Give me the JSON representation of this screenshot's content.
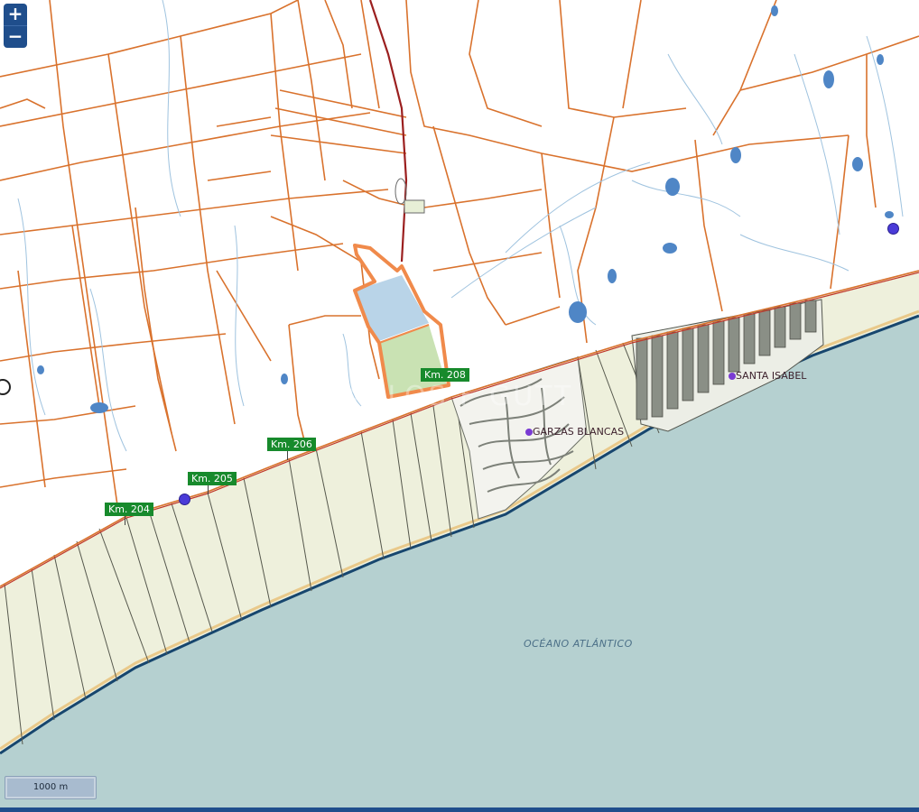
{
  "map": {
    "zoom_in_label": "+",
    "zoom_out_label": "−",
    "scale_label": "1000 m",
    "ocean_label": "OCÉANO ATLÁNTICO",
    "watermark": "CARLOS F GUTT",
    "places": [
      {
        "name": "GARZAS BLANCAS"
      },
      {
        "name": "SANTA ISABEL"
      }
    ],
    "km_markers": [
      "Km. 204",
      "Km. 205",
      "Km. 206",
      "Km. 208"
    ],
    "colors": {
      "ocean": "#b5d0d0",
      "parcel_lines": "#d9722d",
      "water": "#4f86c6",
      "coastal_lots": "#eef0dc",
      "highlight_outline": "#f08a4b",
      "highlight_pond": "#b9d4e8",
      "highlight_field": "#c9e2b3",
      "urban": "#8a8f86",
      "km_badge": "#178a2c"
    }
  }
}
